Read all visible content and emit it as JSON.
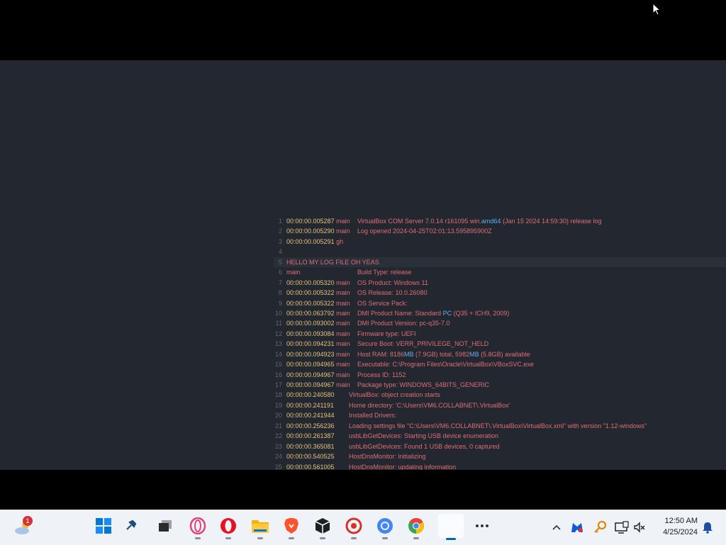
{
  "log": [
    {
      "n": "1",
      "ts": "00:00:00.005287",
      "th": "main",
      "msg": "VirtualBox COM Server 7.0.14 r161095 win.",
      "ty": "amd64",
      "rest": " (Jan 15 2024 14:59:30) release log"
    },
    {
      "n": "2",
      "ts": "00:00:00.005290",
      "th": "main",
      "msg": "Log opened 2024-04-25T02:01:13.595895900Z"
    },
    {
      "n": "3",
      "ts": "00:00:00.005291",
      "th": "gh",
      "msg": ""
    },
    {
      "n": "4",
      "ts": "",
      "th": "",
      "msg": ""
    },
    {
      "n": "5",
      "ts": "",
      "th": "",
      "msg": "HELLO MY LOG FILE OH YEAS",
      "hl": true
    },
    {
      "n": "6",
      "ts": "",
      "th": "main",
      "msg": "Build Type: release"
    },
    {
      "n": "7",
      "ts": "00:00:00.005320",
      "th": "main",
      "msg": "OS Product: Windows 11"
    },
    {
      "n": "8",
      "ts": "00:00:00.005322",
      "th": "main",
      "msg": "OS Release: 10.0.26080"
    },
    {
      "n": "9",
      "ts": "00:00:00.005322",
      "th": "main",
      "msg": "OS Service Pack:"
    },
    {
      "n": "10",
      "ts": "00:00:00.063792",
      "th": "main",
      "msg": "DMI Product Name: Standard ",
      "ty": "PC",
      "rest": " (Q35 + ICH9, 2009)"
    },
    {
      "n": "11",
      "ts": "00:00:00.093002",
      "th": "main",
      "msg": "DMI Product Version: pc-q35-7.0"
    },
    {
      "n": "12",
      "ts": "00:00:00.093084",
      "th": "main",
      "msg": "Firmware type: UEFI"
    },
    {
      "n": "13",
      "ts": "00:00:00.094231",
      "th": "main",
      "msg": "Secure Boot: VERR_PRIVILEGE_NOT_HELD"
    },
    {
      "n": "14",
      "ts": "00:00:00.094923",
      "th": "main",
      "msg": "Host RAM: 8186",
      "ty": "MB",
      "rest": " (7.9GB) total, 5982",
      "ty2": "MB",
      "rest2": " (5.8GB) available"
    },
    {
      "n": "15",
      "ts": "00:00:00.094965",
      "th": "main",
      "msg": "Executable: C:\\Program Files\\Oracle\\VirtualBox\\VBoxSVC.exe"
    },
    {
      "n": "16",
      "ts": "00:00:00.094967",
      "th": "main",
      "msg": "Process ID: 1152"
    },
    {
      "n": "17",
      "ts": "00:00:00.094967",
      "th": "main",
      "msg": "Package type: WINDOWS_64BITS_GENERIC"
    },
    {
      "n": "18",
      "ts": "00:00:00.240580",
      "th": "",
      "msg": "VirtualBox: object creation starts"
    },
    {
      "n": "19",
      "ts": "00:00:00.241191",
      "th": "",
      "msg": "Home directory: 'C:\\Users\\VM6.COLLABNET\\.VirtualBox'"
    },
    {
      "n": "20",
      "ts": "00:00:00.241944",
      "th": "",
      "msg": "Installed Drivers:"
    },
    {
      "n": "21",
      "ts": "00:00:00.256236",
      "th": "",
      "msg": "Loading settings file \"C:\\Users\\VM6.COLLABNET\\.VirtualBox\\VirtualBox.xml\" with version \"1.12-windows\""
    },
    {
      "n": "22",
      "ts": "00:00:00.261387",
      "th": "",
      "msg": "usbLibGetDevices: Starting USB device enumeration"
    },
    {
      "n": "23",
      "ts": "00:00:00.365081",
      "th": "",
      "msg": "usbLibGetDevices: Found 1 USB devices, 0 captured"
    },
    {
      "n": "24",
      "ts": "00:00:00.540525",
      "th": "",
      "msg": "HostDnsMonitor: initializing"
    },
    {
      "n": "25",
      "ts": "00:00:00.561005",
      "th": "",
      "msg": "HostDnsMonitor: updating information"
    }
  ],
  "taskbar": {
    "weather_badge": "1",
    "icons": [
      "weather-icon",
      "start-icon",
      "tools-icon",
      "task-view-icon",
      "opera-gx-icon",
      "opera-icon",
      "file-explorer-icon",
      "brave-icon",
      "box-icon",
      "app-icon",
      "chromium-icon",
      "chrome-icon",
      "blank-app-icon",
      "more-icon"
    ]
  },
  "clock": {
    "time": "12:50 AM",
    "date": "4/25/2024"
  },
  "colors": {
    "editor_bg": "#232830",
    "timestamp": "#e5c07b",
    "message": "#e06c75",
    "type": "#61afef"
  }
}
